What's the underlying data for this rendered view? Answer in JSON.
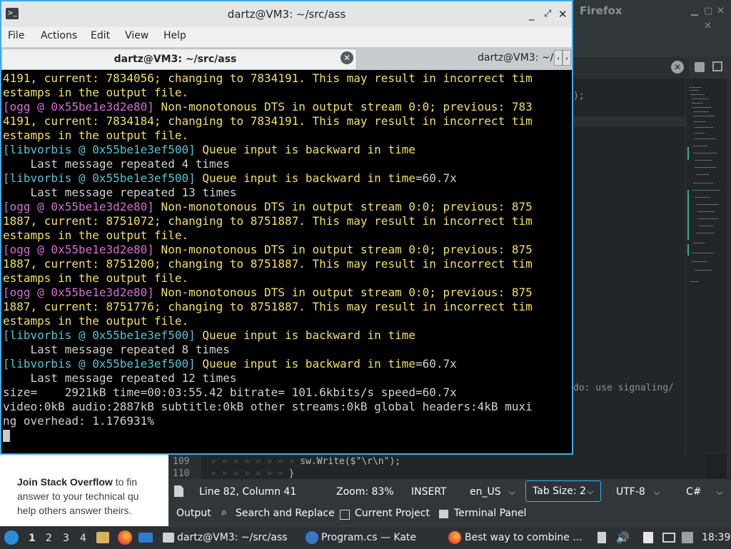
{
  "firefox": {
    "title_fragment": "Firefox",
    "minimize": "▁",
    "maximize": "▢",
    "close": "✕"
  },
  "kate": {
    "code_fragment": ");",
    "todo_fragment": "do: use signaling/",
    "code_lines": [
      {
        "num": "109",
        "code": "sw.Write($\"\\r\\n\");"
      },
      {
        "num": "110",
        "code": "}"
      }
    ],
    "status": {
      "position": "Line 82, Column 41",
      "zoom": "Zoom: 83%",
      "mode": "INSERT",
      "language": "en_US",
      "tab_size": "Tab Size: 2",
      "encoding": "UTF-8",
      "syntax": "C#"
    },
    "panels": {
      "output": "Output",
      "search": "Search and Replace",
      "project": "Current Project",
      "terminal": "Terminal Panel"
    }
  },
  "stackoverflow": {
    "heading": "Join Stack Overflow",
    "text1": " to fin",
    "text2": "answer to your technical qu",
    "text3": "help others answer theirs."
  },
  "terminal": {
    "title": "dartz@VM3: ~/src/ass",
    "menu": [
      "File",
      "Actions",
      "Edit",
      "View",
      "Help"
    ],
    "tab_active": "dartz@VM3: ~/src/ass",
    "tab_inactive": "dartz@VM3: ~/",
    "tab_scroll_left": "‹",
    "tab_scroll_right": "›",
    "lines": [
      {
        "segs": [
          {
            "c": "y",
            "t": "4191, current: 7834056; changing to 7834191. This may result in incorrect tim"
          }
        ]
      },
      {
        "segs": [
          {
            "c": "y",
            "t": "estamps in the output file."
          }
        ]
      },
      {
        "segs": [
          {
            "c": "m",
            "t": "[ogg @ 0x55be1e3d2e80]"
          },
          {
            "c": "y",
            "t": " Non-monotonous DTS in output stream 0:0; previous: 783"
          }
        ]
      },
      {
        "segs": [
          {
            "c": "y",
            "t": "4191, current: 7834184; changing to 7834191. This may result in incorrect tim"
          }
        ]
      },
      {
        "segs": [
          {
            "c": "y",
            "t": "estamps in the output file."
          }
        ]
      },
      {
        "segs": [
          {
            "c": "c",
            "t": "[libvorbis @ 0x55be1e3ef500]"
          },
          {
            "c": "y",
            "t": " Queue input is backward in time"
          }
        ]
      },
      {
        "segs": [
          {
            "c": "w",
            "t": "    Last message repeated 4 times"
          }
        ]
      },
      {
        "segs": [
          {
            "c": "c",
            "t": "[libvorbis @ 0x55be1e3ef500]"
          },
          {
            "c": "y",
            "t": " Queue input is backward in time"
          },
          {
            "c": "w",
            "t": "=60.7x"
          }
        ]
      },
      {
        "segs": [
          {
            "c": "w",
            "t": "    Last message repeated 13 times"
          }
        ]
      },
      {
        "segs": [
          {
            "c": "m",
            "t": "[ogg @ 0x55be1e3d2e80]"
          },
          {
            "c": "y",
            "t": " Non-monotonous DTS in output stream 0:0; previous: 875"
          }
        ]
      },
      {
        "segs": [
          {
            "c": "y",
            "t": "1887, current: 8751072; changing to 8751887. This may result in incorrect tim"
          }
        ]
      },
      {
        "segs": [
          {
            "c": "y",
            "t": "estamps in the output file."
          }
        ]
      },
      {
        "segs": [
          {
            "c": "m",
            "t": "[ogg @ 0x55be1e3d2e80]"
          },
          {
            "c": "y",
            "t": " Non-monotonous DTS in output stream 0:0; previous: 875"
          }
        ]
      },
      {
        "segs": [
          {
            "c": "y",
            "t": "1887, current: 8751200; changing to 8751887. This may result in incorrect tim"
          }
        ]
      },
      {
        "segs": [
          {
            "c": "y",
            "t": "estamps in the output file."
          }
        ]
      },
      {
        "segs": [
          {
            "c": "m",
            "t": "[ogg @ 0x55be1e3d2e80]"
          },
          {
            "c": "y",
            "t": " Non-monotonous DTS in output stream 0:0; previous: 875"
          }
        ]
      },
      {
        "segs": [
          {
            "c": "y",
            "t": "1887, current: 8751776; changing to 8751887. This may result in incorrect tim"
          }
        ]
      },
      {
        "segs": [
          {
            "c": "y",
            "t": "estamps in the output file."
          }
        ]
      },
      {
        "segs": [
          {
            "c": "c",
            "t": "[libvorbis @ 0x55be1e3ef500]"
          },
          {
            "c": "y",
            "t": " Queue input is backward in time"
          }
        ]
      },
      {
        "segs": [
          {
            "c": "w",
            "t": "    Last message repeated 8 times"
          }
        ]
      },
      {
        "segs": [
          {
            "c": "c",
            "t": "[libvorbis @ 0x55be1e3ef500]"
          },
          {
            "c": "y",
            "t": " Queue input is backward in time"
          },
          {
            "c": "w",
            "t": "=60.7x"
          }
        ]
      },
      {
        "segs": [
          {
            "c": "w",
            "t": "    Last message repeated 12 times"
          }
        ]
      },
      {
        "segs": [
          {
            "c": "w",
            "t": "size=    2921kB time=00:03:55.42 bitrate= 101.6kbits/s speed=60.7x"
          }
        ]
      },
      {
        "segs": [
          {
            "c": "w",
            "t": "video:0kB audio:2887kB subtitle:0kB other streams:0kB global headers:4kB muxi"
          }
        ]
      },
      {
        "segs": [
          {
            "c": "w",
            "t": "ng overhead: 1.176931%"
          }
        ]
      }
    ]
  },
  "taskbar": {
    "desktops": [
      "1",
      "2",
      "3",
      "4"
    ],
    "tasks": [
      {
        "label": "dartz@VM3: ~/src/ass"
      },
      {
        "label": "Program.cs — Kate"
      },
      {
        "label": "Best way to combine ..."
      }
    ],
    "clock": "18:39"
  },
  "colors": {
    "accent": "#3daee9",
    "terminal_bg": "#000000",
    "log_yellow": "#f5e05a",
    "log_magenta": "#d56ed8",
    "log_cyan": "#4fc6d8"
  }
}
